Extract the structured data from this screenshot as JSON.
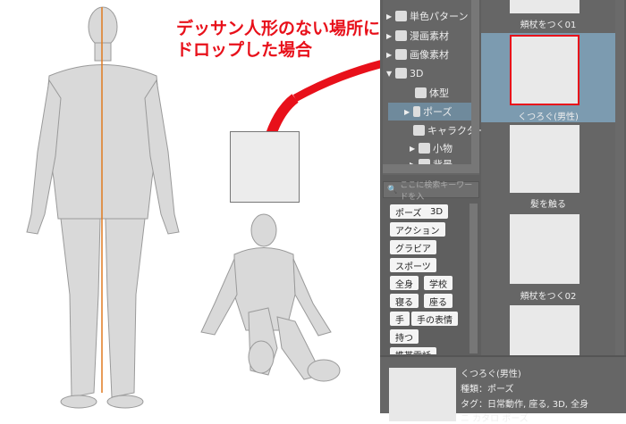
{
  "caption": {
    "line1": "デッサン人形のない場所に",
    "line2": "ドロップした場合"
  },
  "tree": {
    "items": [
      {
        "label": "単色パターン",
        "arrow": "▶"
      },
      {
        "label": "漫画素材",
        "arrow": "▶"
      },
      {
        "label": "画像素材",
        "arrow": "▶"
      },
      {
        "label": "3D",
        "arrow": "▼"
      },
      {
        "label": "体型",
        "arrow": ""
      },
      {
        "label": "ポーズ",
        "arrow": "▶"
      },
      {
        "label": "キャラクター",
        "arrow": ""
      },
      {
        "label": "小物",
        "arrow": "▶"
      },
      {
        "label": "背景",
        "arrow": "▶"
      }
    ]
  },
  "search": {
    "placeholder": "ここに検索キーワードを入"
  },
  "tags": [
    "ポーズ",
    "3D",
    "アクション",
    "グラビア",
    "スポーツ",
    "全身",
    "学校",
    "寝る",
    "座る",
    "手",
    "手の表情",
    "持つ",
    "携帯電話"
  ],
  "materials": [
    "頬杖をつく01",
    "くつろぐ(男性)",
    "髪を触る",
    "頬杖をつく02"
  ],
  "info": {
    "name": "くつろぐ(男性)",
    "type": "種類：ポーズ",
    "tags": "タグ：日常動作, 座る, 3D, 全身",
    "more": "ニ カタロ ポーズ"
  },
  "colors": {
    "accent": "#e8101a",
    "selected": "#7c9bb0"
  }
}
